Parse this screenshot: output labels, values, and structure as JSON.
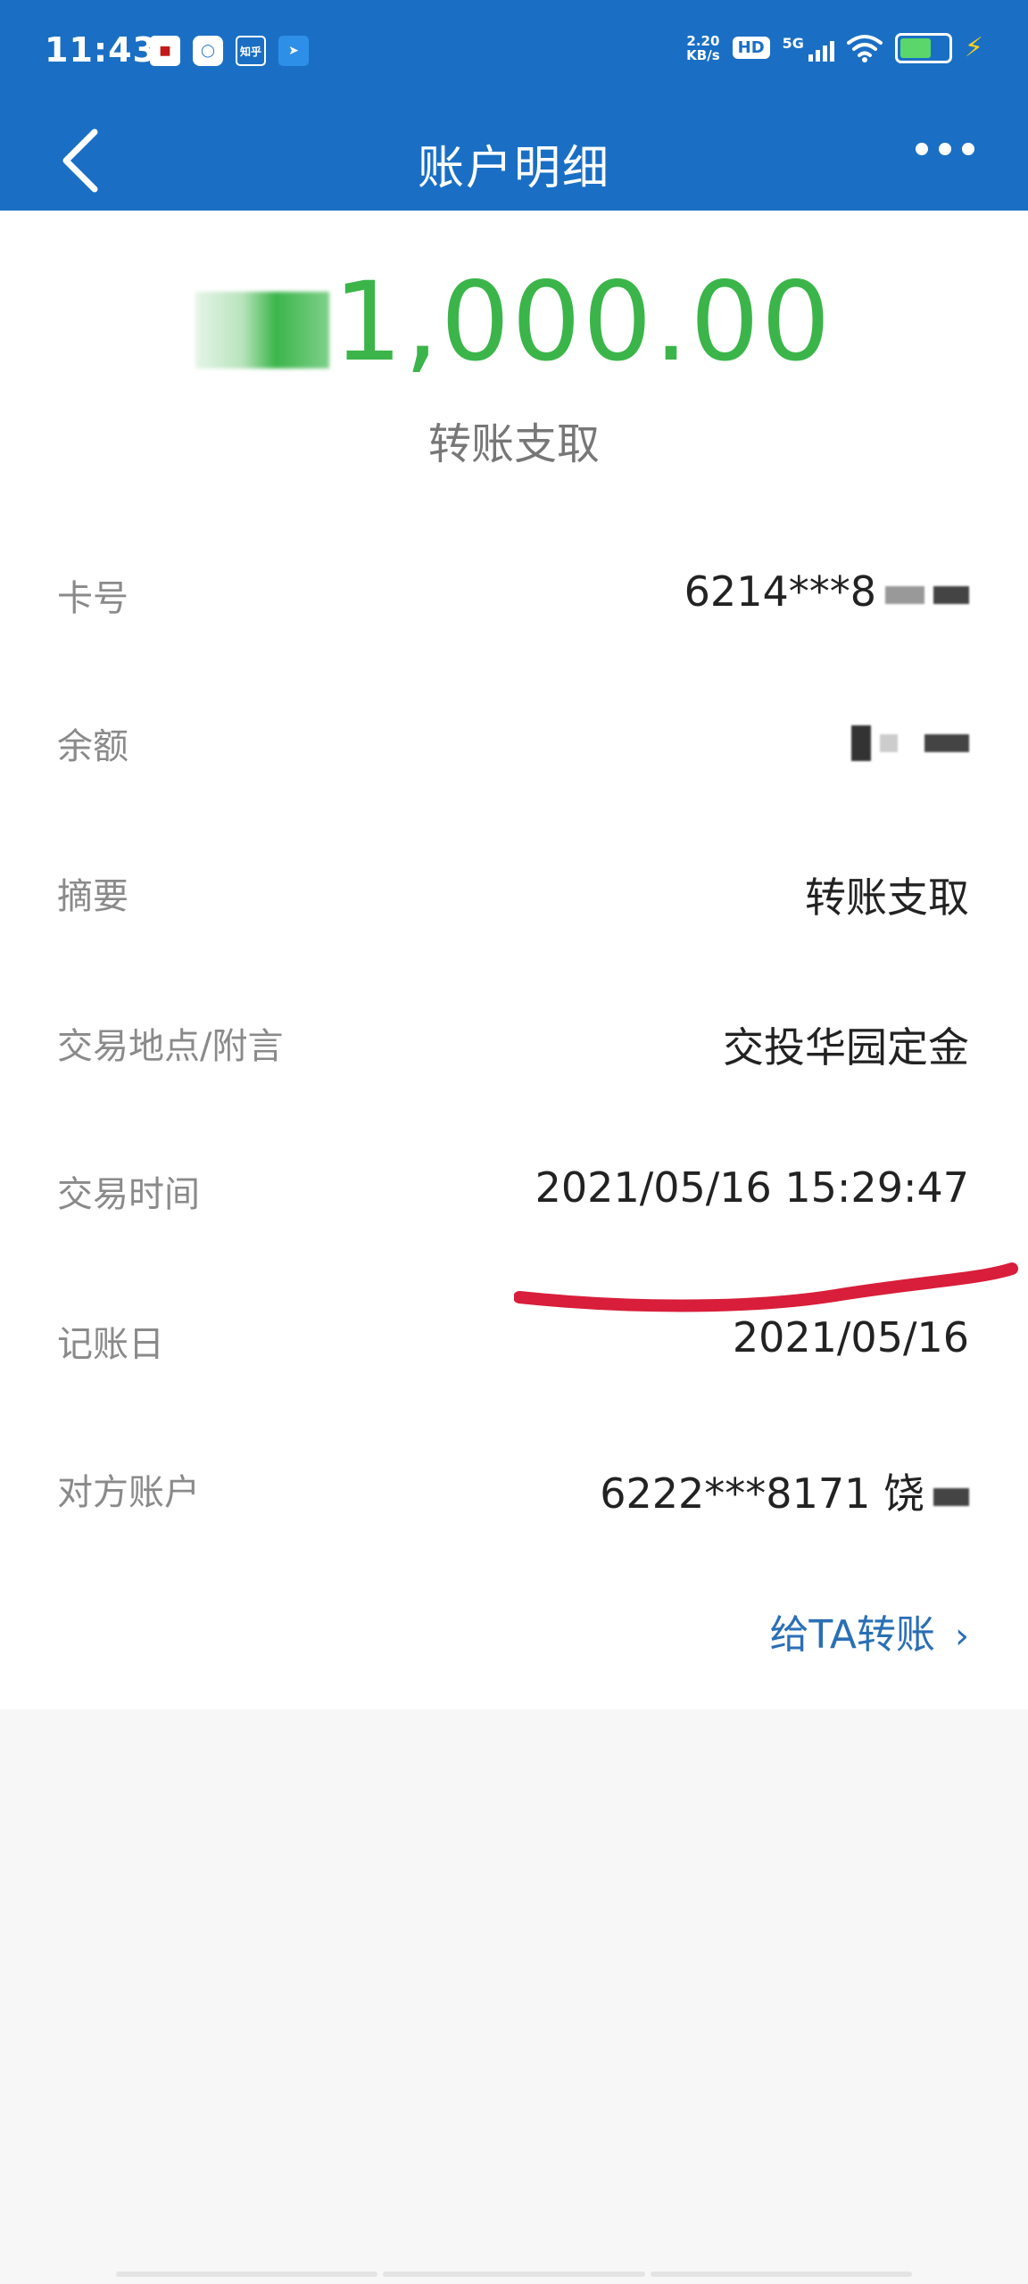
{
  "status_bar": {
    "time": "11:43",
    "net_speed_top": "2.20",
    "net_speed_bottom": "KB/s",
    "hd": "HD",
    "network": "5G",
    "notification_icons": [
      "app-red-icon",
      "chat-icon",
      "zhihu-icon",
      "location-arrow-icon"
    ],
    "zhihu": "知乎"
  },
  "nav": {
    "title": "账户明细"
  },
  "transaction": {
    "amount_visible": "1,000.00",
    "type": "转账支取",
    "rows": [
      {
        "key": "卡号",
        "value": "6214***8"
      },
      {
        "key": "余额",
        "value": ""
      },
      {
        "key": "摘要",
        "value": "转账支取"
      },
      {
        "key": "交易地点/附言",
        "value": "交投华园定金"
      },
      {
        "key": "交易时间",
        "value": "2021/05/16 15:29:47"
      },
      {
        "key": "记账日",
        "value": "2021/05/16"
      },
      {
        "key": "对方账户",
        "value": "6222***8171 饶"
      }
    ],
    "transfer_link": "给TA转账",
    "transfer_chevron": "›"
  },
  "colors": {
    "header_blue": "#1a6fc4",
    "amount_green": "#3bb54a",
    "link_blue": "#2a6fb5",
    "annotation_red": "#d81e3a"
  }
}
